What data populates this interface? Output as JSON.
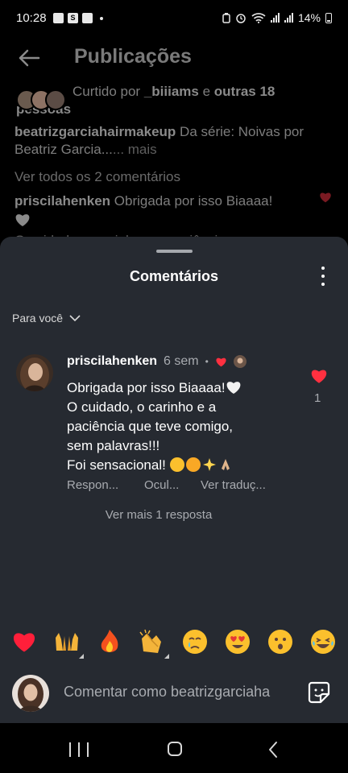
{
  "status_bar": {
    "time": "10:28",
    "battery": "14%",
    "icons": [
      "gallery-icon",
      "s-app-icon",
      "app-icon",
      "dot-icon",
      "lock-battery-icon",
      "alarm-icon",
      "wifi-icon",
      "signal-icon",
      "signal-icon",
      "battery-icon"
    ]
  },
  "header": {
    "title": "Publicações",
    "back_icon": "arrow-left-icon"
  },
  "post": {
    "likes_prefix": "Curtido por ",
    "likes_user": "_biiiams",
    "likes_mid": " e ",
    "likes_others": "outras 18",
    "likes_suffix": "pessoas",
    "caption_user": "beatrizgarciahairmakeup",
    "caption_text": " Da série: Noivas por Beatriz Garcia...",
    "caption_more": "... mais",
    "view_all_comments": "Ver todos os 2 comentários",
    "comment_user": "priscilahenken",
    "comment_text": " Obrigada por isso Biaaaa!",
    "cut_text": "O cuidado, o carinho e a paciência..."
  },
  "sheet": {
    "title": "Comentários",
    "filter_label": "Para você",
    "comment": {
      "username": "priscilahenken",
      "time": "6 sem",
      "separator": "•",
      "lines": [
        "Obrigada por isso Biaaaa!",
        "O cuidado, o carinho e a",
        "paciência que teve comigo,",
        "sem palavras!!!",
        "Foi sensacional!"
      ],
      "like_count": "1",
      "actions": {
        "reply": "Respon...",
        "hide": "Ocul...",
        "translate": "Ver traduç..."
      },
      "more_replies": "Ver mais 1 resposta"
    },
    "quick_reactions": [
      "heart",
      "raising-hands",
      "fire",
      "clapping-hands",
      "crying-face",
      "heart-eyes",
      "surprised-face",
      "laughing-face"
    ],
    "input": {
      "placeholder": "Comentar como beatrizgarciaha",
      "value": ""
    }
  },
  "colors": {
    "sheet_bg": "#262a31",
    "like_red": "#ff3040",
    "muted_text": "#a8abb0"
  }
}
